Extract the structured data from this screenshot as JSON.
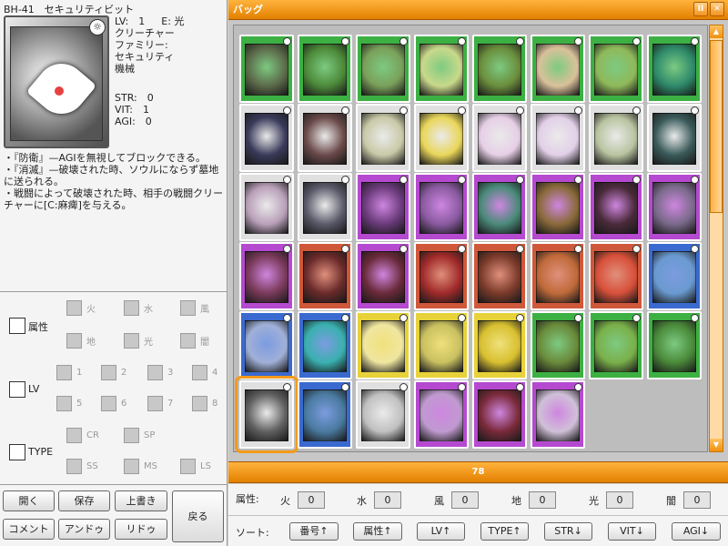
{
  "card": {
    "header": "BH-41　セキュリティビット",
    "lv": "LV:　1",
    "element": "E: 光",
    "type": "クリーチャー",
    "family_label": "ファミリー:",
    "family_1": "セキュリティ",
    "family_2": "機械",
    "str": "STR:　0",
    "vit": "VIT:　1",
    "agi": "AGI:　0",
    "desc": [
      "・『防衛』—AGIを無視してブロックできる。",
      "・『消滅』—破壊された時、ソウルにならず墓地に送られる。",
      "・戦闘によって破壊された時、相手の戦闘クリーチャーに[C:麻痺]を与える。"
    ]
  },
  "filters": {
    "attr_label": "属性",
    "attr_options": [
      "火",
      "水",
      "風",
      "地",
      "光",
      "闇"
    ],
    "lv_label": "LV",
    "lv_options": [
      "1",
      "2",
      "3",
      "4",
      "5",
      "6",
      "7",
      "8"
    ],
    "type_label": "TYPE",
    "type_options": [
      "CR",
      "SP",
      "SS",
      "MS",
      "LS"
    ]
  },
  "buttons": {
    "open": "開く",
    "save": "保存",
    "overwrite": "上書き",
    "back": "戻る",
    "comment": "コメント",
    "undo": "アンドゥ",
    "redo": "リドゥ"
  },
  "bag": {
    "title": "バッグ",
    "min_icon": "pause-icon",
    "close_icon": "close-icon",
    "count": "78",
    "cards": [
      {
        "frame": "#3cb043",
        "art": "#5c6a4a"
      },
      {
        "frame": "#3cb043",
        "art": "#4d8a3a"
      },
      {
        "frame": "#3cb043",
        "art": "#7aa05a"
      },
      {
        "frame": "#3cb043",
        "art": "#c9d98a"
      },
      {
        "frame": "#3cb043",
        "art": "#6a8e3c"
      },
      {
        "frame": "#3cb043",
        "art": "#d9c19a"
      },
      {
        "frame": "#3cb043",
        "art": "#8fb95a"
      },
      {
        "frame": "#3cb043",
        "art": "#2e8a6a"
      },
      {
        "frame": "#e0e0e0",
        "art": "#3a3a5a"
      },
      {
        "frame": "#e0e0e0",
        "art": "#6b4a4a"
      },
      {
        "frame": "#e0e0e0",
        "art": "#c9c9a8"
      },
      {
        "frame": "#e0e0e0",
        "art": "#e9d65a"
      },
      {
        "frame": "#e0e0e0",
        "art": "#e6cfe6"
      },
      {
        "frame": "#e0e0e0",
        "art": "#e2d0e8"
      },
      {
        "frame": "#e0e0e0",
        "art": "#b9c4a0"
      },
      {
        "frame": "#e0e0e0",
        "art": "#3a5a5a"
      },
      {
        "frame": "#e0e0e0",
        "art": "#b9a0b9"
      },
      {
        "frame": "#e0e0e0",
        "art": "#5a5a6a"
      },
      {
        "frame": "#b54ad0",
        "art": "#6a3a7a"
      },
      {
        "frame": "#b54ad0",
        "art": "#8a5aa0"
      },
      {
        "frame": "#b54ad0",
        "art": "#4a8a7a"
      },
      {
        "frame": "#b54ad0",
        "art": "#8a6a3a"
      },
      {
        "frame": "#b54ad0",
        "art": "#4a2a3a"
      },
      {
        "frame": "#b54ad0",
        "art": "#7a6a8a"
      },
      {
        "frame": "#b54ad0",
        "art": "#7a3a5a"
      },
      {
        "frame": "#d0583a",
        "art": "#6a2a2a"
      },
      {
        "frame": "#b54ad0",
        "art": "#6a2a3a"
      },
      {
        "frame": "#d0583a",
        "art": "#a02a2a"
      },
      {
        "frame": "#d0583a",
        "art": "#7a3a2a"
      },
      {
        "frame": "#d0583a",
        "art": "#c06a3a"
      },
      {
        "frame": "#d0583a",
        "art": "#d8503a"
      },
      {
        "frame": "#3a6ad0",
        "art": "#6a9ad0"
      },
      {
        "frame": "#3a6ad0",
        "art": "#a0b0d8"
      },
      {
        "frame": "#3a6ad0",
        "art": "#3ab0b0"
      },
      {
        "frame": "#e8d23a",
        "art": "#f0e6a0"
      },
      {
        "frame": "#e8d23a",
        "art": "#c9c060"
      },
      {
        "frame": "#e8d23a",
        "art": "#d8c030"
      },
      {
        "frame": "#3cb043",
        "art": "#6a8a3a"
      },
      {
        "frame": "#3cb043",
        "art": "#7ab04a"
      },
      {
        "frame": "#3cb043",
        "art": "#4a8a3a"
      },
      {
        "frame": "#e0e0e0",
        "art": "#606060",
        "selected": true
      },
      {
        "frame": "#3a6ad0",
        "art": "#4a7aa0"
      },
      {
        "frame": "#e0e0e0",
        "art": "#c0c0c0"
      },
      {
        "frame": "#b54ad0",
        "art": "#c09ad0"
      },
      {
        "frame": "#b54ad0",
        "art": "#7a2a3a"
      },
      {
        "frame": "#b54ad0",
        "art": "#d0c0d8"
      }
    ]
  },
  "attrs": {
    "label": "属性:",
    "items": [
      {
        "name": "火",
        "value": "0"
      },
      {
        "name": "水",
        "value": "0"
      },
      {
        "name": "風",
        "value": "0"
      },
      {
        "name": "地",
        "value": "0"
      },
      {
        "name": "光",
        "value": "0"
      },
      {
        "name": "闇",
        "value": "0"
      }
    ]
  },
  "sort": {
    "label": "ソート:",
    "buttons": [
      "番号↑",
      "属性↑",
      "LV↑",
      "TYPE↑",
      "STR↓",
      "VIT↓",
      "AGI↓"
    ]
  },
  "colors": {
    "accent_orange": "#f49a1c",
    "frame_green": "#3cb043",
    "frame_purple": "#b54ad0",
    "frame_red": "#d0583a",
    "frame_blue": "#3a6ad0",
    "frame_yellow": "#e8d23a"
  }
}
